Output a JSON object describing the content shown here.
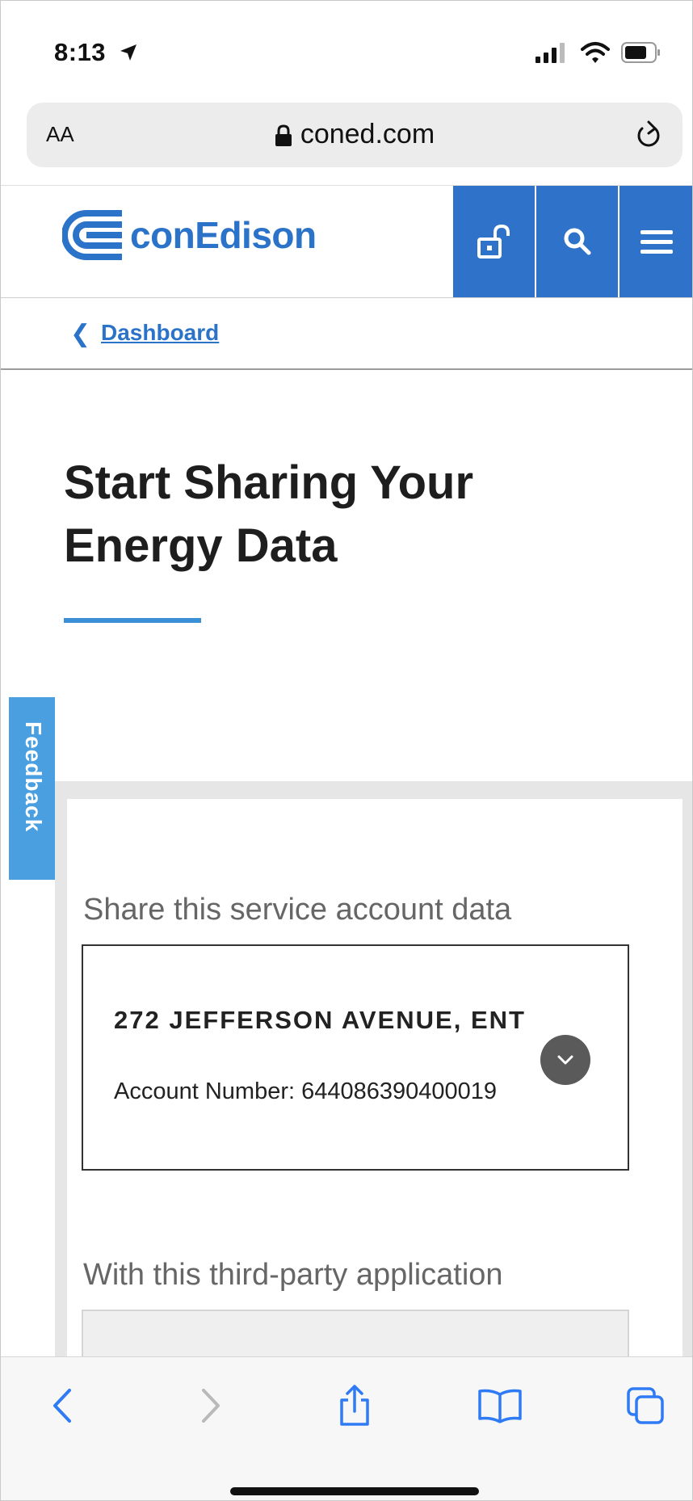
{
  "status_bar": {
    "time": "8:13"
  },
  "browser": {
    "text_size_label": "AA",
    "url": "coned.com"
  },
  "site": {
    "logo_text": "conEdison",
    "brand_color": "#2e73c9"
  },
  "breadcrumb": {
    "link": "Dashboard"
  },
  "page": {
    "title": "Start Sharing Your Energy Data",
    "feedback_label": "Feedback"
  },
  "form": {
    "account_section_label": "Share this service account data",
    "selected_account": {
      "address": "272 JEFFERSON AVENUE, ENT",
      "account_number": "Account Number: 644086390400019"
    },
    "application_section_label": "With this third-party application"
  },
  "icons": {
    "header": [
      "login-lock-icon",
      "search-icon",
      "menu-icon"
    ],
    "toolbar": [
      "back-icon",
      "forward-icon",
      "share-icon",
      "bookmarks-icon",
      "tabs-icon"
    ]
  }
}
